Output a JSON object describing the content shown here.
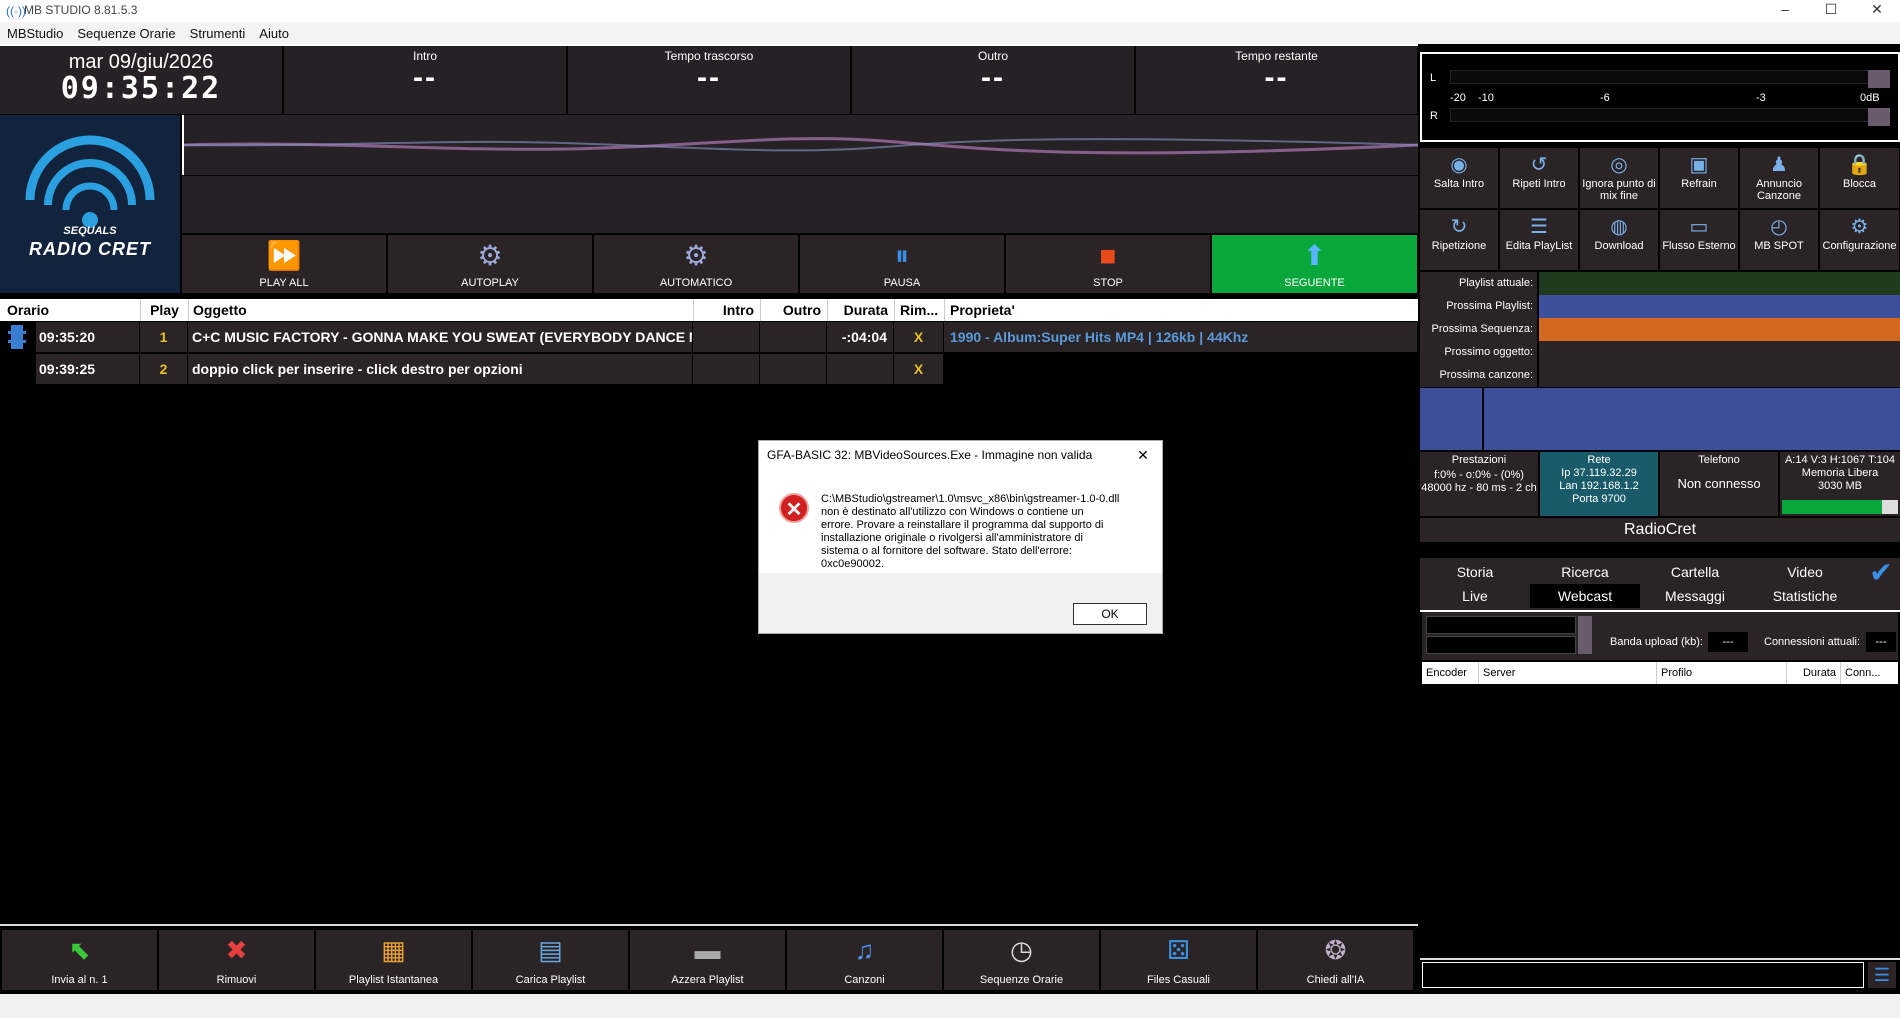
{
  "window": {
    "title": "MB STUDIO 8.81.5.3",
    "minimize": "–",
    "maximize": "☐",
    "close": "✕"
  },
  "menu": [
    "MBStudio",
    "Sequenze Orarie",
    "Strumenti",
    "Aiuto"
  ],
  "clock": {
    "date": "mar 09/giu/2026",
    "time": "09:35:22"
  },
  "timers": [
    {
      "label": "Intro",
      "value": "--"
    },
    {
      "label": "Tempo trascorso",
      "value": "--"
    },
    {
      "label": "Outro",
      "value": "--"
    },
    {
      "label": "Tempo restante",
      "value": "--"
    }
  ],
  "logo": {
    "line1": "SEQUALS",
    "line2": "RADIO CRET"
  },
  "controls": [
    {
      "label": "PLAY ALL",
      "icon": "play-all-icon",
      "glyph": "⏩"
    },
    {
      "label": "AUTOPLAY",
      "icon": "gear-icon",
      "glyph": "⚙"
    },
    {
      "label": "AUTOMATICO",
      "icon": "gears-icon",
      "glyph": "⚙"
    },
    {
      "label": "PAUSA",
      "icon": "pause-icon",
      "glyph": "⏸"
    },
    {
      "label": "STOP",
      "icon": "stop-icon",
      "glyph": "■"
    },
    {
      "label": "SEGUENTE",
      "icon": "arrow-up-icon",
      "glyph": "⬆"
    }
  ],
  "playlist": {
    "headers": [
      "Orario",
      "Play",
      "Oggetto",
      "Intro",
      "Outro",
      "Durata",
      "Rim...",
      "Proprieta'"
    ],
    "rows": [
      {
        "orario": "09:35:20",
        "play": "1",
        "oggetto": "C+C MUSIC FACTORY - GONNA MAKE YOU SWEAT (EVERYBODY DANCE N...",
        "intro": "",
        "outro": "",
        "durata": "-:04:04",
        "rim": "X",
        "proprieta": "1990 - Album:Super Hits MP4 | 126kb | 44Khz"
      },
      {
        "orario": "09:39:25",
        "play": "2",
        "oggetto": "doppio click per inserire - click destro per opzioni",
        "intro": "",
        "outro": "",
        "durata": "",
        "rim": "X",
        "proprieta": ""
      }
    ]
  },
  "bottom_buttons": [
    {
      "label": "Invia al n. 1",
      "icon": "arrow-up-left-icon",
      "glyph": "⬉",
      "color": "#3cc83c"
    },
    {
      "label": "Rimuovi",
      "icon": "remove-x-icon",
      "glyph": "✖",
      "color": "#e84040"
    },
    {
      "label": "Playlist Istantanea",
      "icon": "grid-icon",
      "glyph": "▦",
      "color": "#e8a030"
    },
    {
      "label": "Carica Playlist",
      "icon": "calendar-icon",
      "glyph": "▤",
      "color": "#6aa8e0"
    },
    {
      "label": "Azzera Playlist",
      "icon": "eraser-icon",
      "glyph": "▬",
      "color": "#aaaaaa"
    },
    {
      "label": "Canzoni",
      "icon": "music-note-icon",
      "glyph": "♫",
      "color": "#4a90e8"
    },
    {
      "label": "Sequenze Orarie",
      "icon": "clock-icon",
      "glyph": "◷",
      "color": "#dddddd"
    },
    {
      "label": "Files Casuali",
      "icon": "dice-icon",
      "glyph": "⚄",
      "color": "#3a90e0"
    },
    {
      "label": "Chiedi all'IA",
      "icon": "brain-icon",
      "glyph": "❂",
      "color": "#c0b0c8"
    }
  ],
  "meter": {
    "L": "L",
    "R": "R",
    "scale": [
      "-20",
      "-10",
      "-6",
      "-3",
      "0dB"
    ]
  },
  "right_buttons_row1": [
    {
      "label": "Salta Intro",
      "icon": "skip-intro-icon",
      "glyph": "◉"
    },
    {
      "label": "Ripeti Intro",
      "icon": "repeat-icon",
      "glyph": "↺"
    },
    {
      "label": "Ignora punto di mix fine",
      "icon": "disc-icon",
      "glyph": "◎"
    },
    {
      "label": "Refrain",
      "icon": "refrain-icon",
      "glyph": "▣"
    },
    {
      "label": "Annuncio Canzone",
      "icon": "people-icon",
      "glyph": "♟"
    },
    {
      "label": "Blocca",
      "icon": "lock-icon",
      "glyph": "🔒"
    }
  ],
  "right_buttons_row2": [
    {
      "label": "Ripetizione",
      "icon": "loop-icon",
      "glyph": "↻"
    },
    {
      "label": "Edita PlayList",
      "icon": "list-icon",
      "glyph": "☰"
    },
    {
      "label": "Download",
      "icon": "globe-icon",
      "glyph": "◍"
    },
    {
      "label": "Flusso Esterno",
      "icon": "monitor-icon",
      "glyph": "▭"
    },
    {
      "label": "MB SPOT",
      "icon": "clock-spot-icon",
      "glyph": "◴"
    },
    {
      "label": "Configurazione",
      "icon": "gear-icon",
      "glyph": "⚙"
    }
  ],
  "info_rows": [
    {
      "key": "Playlist attuale:",
      "color": "#1f3a1f"
    },
    {
      "key": "Prossima Playlist:",
      "color": "#3d4f9a"
    },
    {
      "key": "Prossima Sequenza:",
      "color": "#d2691e"
    },
    {
      "key": "Prossimo oggetto:",
      "color": "#2a2427"
    },
    {
      "key": "Prossima canzone:",
      "color": "#2a2427"
    }
  ],
  "status": {
    "prestazioni": {
      "title": "Prestazioni",
      "line1": "f:0% - o:0% - (0%)",
      "line2": "48000 hz - 80 ms - 2 ch"
    },
    "rete": {
      "title": "Rete",
      "line1": "Ip 37.119.32.29",
      "line2": "Lan 192.168.1.2",
      "line3": "Porta 9700"
    },
    "telefono": {
      "title": "Telefono",
      "value": "Non connesso"
    },
    "memoria": {
      "line1": "A:14 V:3 H:1067 T:104",
      "line2": "Memoria Libera",
      "line3": "3030 MB",
      "fill": 0.86
    }
  },
  "station": "RadioCret",
  "tabs_row1": [
    "Storia",
    "Ricerca",
    "Cartella",
    "Video"
  ],
  "tabs_row2": [
    "Live",
    "Webcast",
    "Messaggi",
    "Statistiche"
  ],
  "active_tab": "Webcast",
  "webcast": {
    "upload_label": "Banda upload (kb):",
    "upload_value": "---",
    "connections_label": "Connessioni attuali:",
    "connections_value": "---",
    "columns": [
      "Encoder",
      "Server",
      "Profilo",
      "Durata",
      "Conn..."
    ]
  },
  "dialog": {
    "title": "GFA-BASIC 32: MBVideoSources.Exe - Immagine non valida",
    "message_lines": [
      "C:\\MBStudio\\gstreamer\\1.0\\msvc_x86\\bin\\gstreamer-1.0-0.dll",
      "non è destinato all'utilizzo con Windows o contiene un",
      "errore. Provare a reinstallare il programma dal supporto di",
      "installazione originale o rivolgersi all'amministratore di",
      "sistema o al fornitore del software. Stato dell'errore:",
      "0xc0e90002."
    ],
    "ok": "OK",
    "close": "✕"
  },
  "colors": {
    "seguente": "#0aa83c",
    "stop": "#e84a1a",
    "panel": "#2a2427",
    "accent_blue": "#3d4f9a"
  }
}
